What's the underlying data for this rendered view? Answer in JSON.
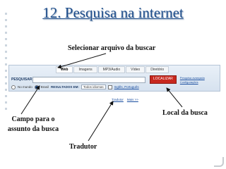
{
  "slide": {
    "title": "12. Pesquisa na internet"
  },
  "annotations": {
    "selecionar": "Selecionar arquivo da buscar",
    "local": "Local da busca",
    "campo_line1": "Campo  para o",
    "campo_line2": "assunto da  busca",
    "tradutor": "Tradutor"
  },
  "toolbar": {
    "tabs": [
      "Web",
      "Imagens",
      "MP3/Audio",
      "Vídeo",
      "Diretório"
    ],
    "active_tab": "Web",
    "search_label": "PESQUISAR",
    "search_value": "",
    "search_button": "LOCALIZAR",
    "links": [
      "Pesquisa avançada",
      "Configurações"
    ],
    "filter": {
      "scope_world": "No mundo",
      "scope_brazil": "Brasil",
      "results_label": "RESULTADOS EM:",
      "language": "Todos idiomas",
      "page_link": "Inglês, Português"
    },
    "translator": [
      "Tradutor",
      "Mais >>"
    ]
  },
  "colors": {
    "title": "#1f4e8c",
    "search_button": "#c8281e",
    "arrow": "#111111"
  }
}
